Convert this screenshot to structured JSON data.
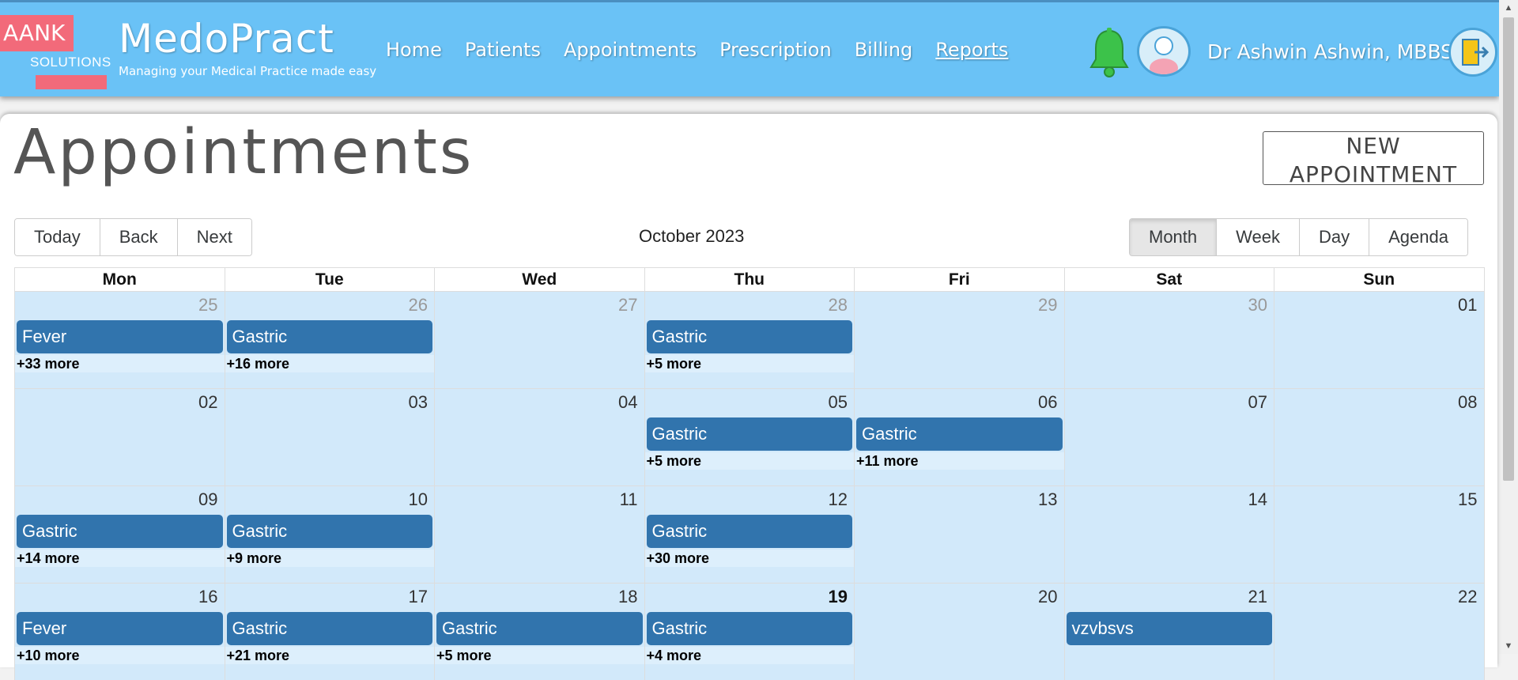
{
  "header": {
    "logo_text": "AANK",
    "logo_sub": "SOLUTIONS",
    "brand": "MedoPract",
    "tagline": "Managing your Medical Practice made easy",
    "nav": [
      "Home",
      "Patients",
      "Appointments",
      "Prescription",
      "Billing",
      "Reports"
    ],
    "doctor_name": "Dr Ashwin  Ashwin, MBBS",
    "icons": [
      "bell-icon",
      "user-avatar-icon",
      "logout-door-icon"
    ]
  },
  "page": {
    "title": "Appointments",
    "new_button_line1": "NEW",
    "new_button_line2": "APPOINTMENT"
  },
  "toolbar": {
    "nav_buttons": [
      "Today",
      "Back",
      "Next"
    ],
    "label": "October 2023",
    "view_buttons": [
      "Month",
      "Week",
      "Day",
      "Agenda"
    ],
    "active_view": "Month"
  },
  "calendar": {
    "weekdays": [
      "Mon",
      "Tue",
      "Wed",
      "Thu",
      "Fri",
      "Sat",
      "Sun"
    ],
    "weeks": [
      [
        {
          "date": "25",
          "off": true,
          "event": "Fever",
          "more": "+33 more"
        },
        {
          "date": "26",
          "off": true,
          "event": "Gastric",
          "more": "+16 more"
        },
        {
          "date": "27",
          "off": true,
          "event": "",
          "more": ""
        },
        {
          "date": "28",
          "off": true,
          "event": "Gastric",
          "more": "+5 more"
        },
        {
          "date": "29",
          "off": true,
          "event": "",
          "more": ""
        },
        {
          "date": "30",
          "off": true,
          "event": "",
          "more": ""
        },
        {
          "date": "01",
          "off": false,
          "event": "",
          "more": ""
        }
      ],
      [
        {
          "date": "02",
          "off": false,
          "event": "",
          "more": ""
        },
        {
          "date": "03",
          "off": false,
          "event": "",
          "more": ""
        },
        {
          "date": "04",
          "off": false,
          "event": "",
          "more": ""
        },
        {
          "date": "05",
          "off": false,
          "event": "Gastric",
          "more": "+5 more"
        },
        {
          "date": "06",
          "off": false,
          "event": "Gastric",
          "more": "+11 more"
        },
        {
          "date": "07",
          "off": false,
          "event": "",
          "more": ""
        },
        {
          "date": "08",
          "off": false,
          "event": "",
          "more": ""
        }
      ],
      [
        {
          "date": "09",
          "off": false,
          "event": "Gastric",
          "more": "+14 more"
        },
        {
          "date": "10",
          "off": false,
          "event": "Gastric",
          "more": "+9 more"
        },
        {
          "date": "11",
          "off": false,
          "event": "",
          "more": ""
        },
        {
          "date": "12",
          "off": false,
          "event": "Gastric",
          "more": "+30 more"
        },
        {
          "date": "13",
          "off": false,
          "event": "",
          "more": ""
        },
        {
          "date": "14",
          "off": false,
          "event": "",
          "more": ""
        },
        {
          "date": "15",
          "off": false,
          "event": "",
          "more": ""
        }
      ],
      [
        {
          "date": "16",
          "off": false,
          "event": "Fever",
          "more": "+10 more"
        },
        {
          "date": "17",
          "off": false,
          "event": "Gastric",
          "more": "+21 more"
        },
        {
          "date": "18",
          "off": false,
          "event": "Gastric",
          "more": "+5 more"
        },
        {
          "date": "19",
          "off": false,
          "today": true,
          "event": "Gastric",
          "more": "+4 more"
        },
        {
          "date": "20",
          "off": false,
          "event": "",
          "more": ""
        },
        {
          "date": "21",
          "off": false,
          "event": "vzvbsvs",
          "more": ""
        },
        {
          "date": "22",
          "off": false,
          "event": "",
          "more": ""
        }
      ]
    ]
  },
  "colors": {
    "header_bg": "#6ac2f6",
    "event_bg": "#3174ad",
    "day_bg": "#d2e9fa",
    "logo_red": "#f26a7a"
  }
}
